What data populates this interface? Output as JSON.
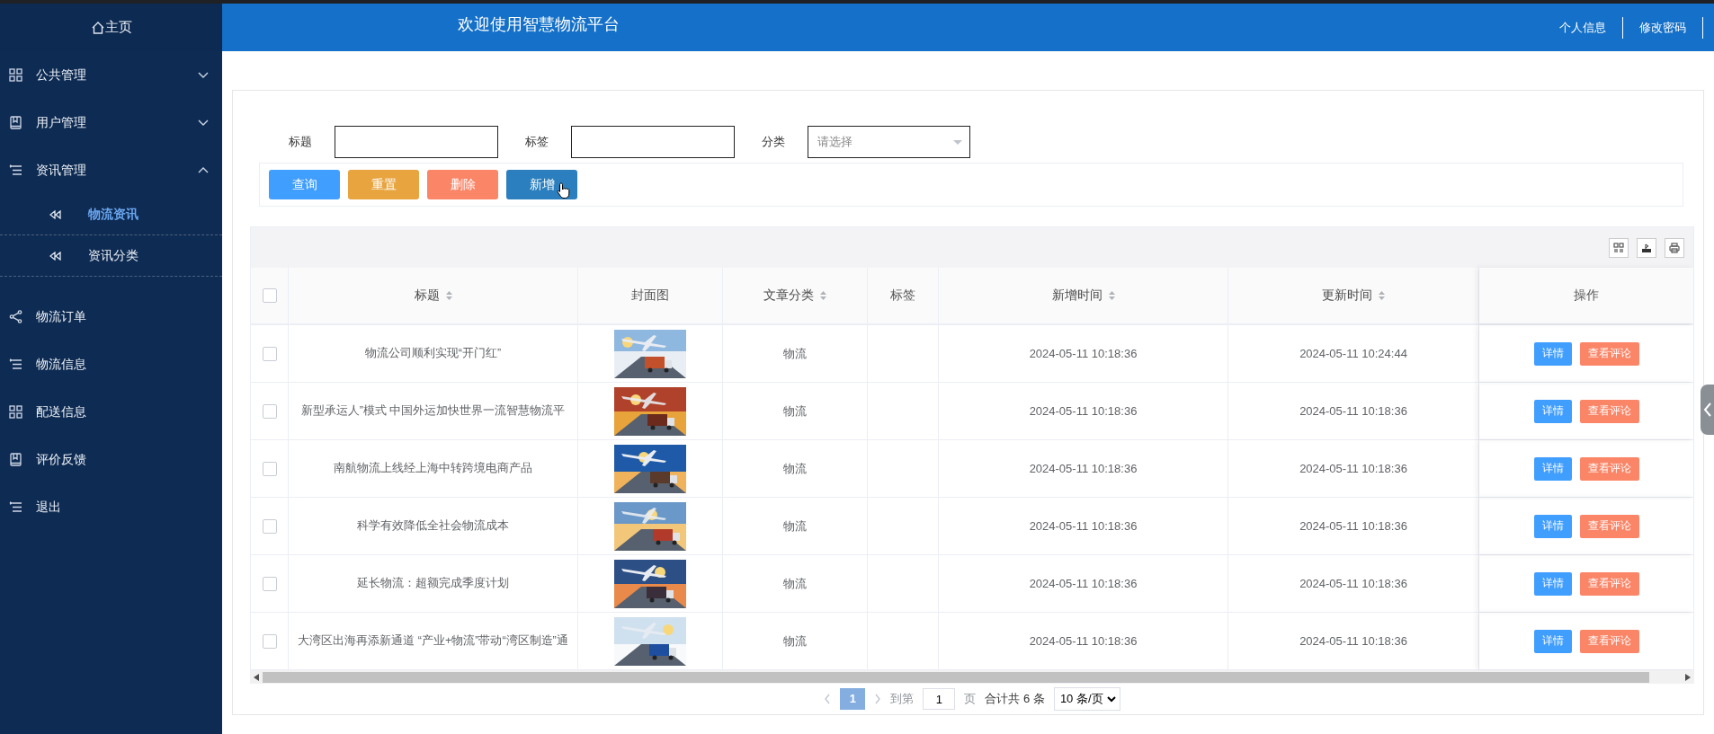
{
  "sidebar": {
    "home": "主页",
    "items": [
      {
        "label": "公共管理",
        "kind": "group",
        "expanded": false
      },
      {
        "label": "用户管理",
        "kind": "group",
        "expanded": false
      },
      {
        "label": "资讯管理",
        "kind": "group",
        "expanded": true,
        "children": [
          {
            "label": "物流资讯",
            "selected": true
          },
          {
            "label": "资讯分类",
            "selected": false
          }
        ]
      },
      {
        "label": "物流订单",
        "kind": "link"
      },
      {
        "label": "物流信息",
        "kind": "link"
      },
      {
        "label": "配送信息",
        "kind": "link"
      },
      {
        "label": "评价反馈",
        "kind": "link"
      },
      {
        "label": "退出",
        "kind": "link"
      }
    ]
  },
  "header": {
    "title": "欢迎使用智慧物流平台",
    "links": [
      "个人信息",
      "修改密码"
    ]
  },
  "filters": [
    {
      "label": "标题",
      "kind": "text"
    },
    {
      "label": "标签",
      "kind": "text"
    },
    {
      "label": "分类",
      "kind": "select",
      "placeholder": "请选择"
    }
  ],
  "actions": [
    {
      "label": "查询",
      "kind": "search",
      "hovered": false
    },
    {
      "label": "重置",
      "kind": "reset",
      "hovered": false
    },
    {
      "label": "删除",
      "kind": "delete",
      "hovered": false
    },
    {
      "label": "新增",
      "kind": "add",
      "hovered": true
    }
  ],
  "table": {
    "all_checked": false,
    "columns": [
      {
        "label": "标题",
        "sortable": true
      },
      {
        "label": "封面图",
        "sortable": false
      },
      {
        "label": "文章分类",
        "sortable": true
      },
      {
        "label": "标签",
        "sortable": false
      },
      {
        "label": "新增时间",
        "sortable": true
      },
      {
        "label": "更新时间",
        "sortable": true
      },
      {
        "label": "操作",
        "sortable": false
      }
    ],
    "rows": [
      {
        "checked": false,
        "title": "物流公司顺利实现“开门红”",
        "cover": {
          "kind": "picture"
        },
        "category": "物流",
        "created": "2024-05-11 10:18:36",
        "updated": "2024-05-11 10:24:44",
        "actions": [
          "详情",
          "查看评论"
        ]
      },
      {
        "checked": false,
        "title": "新型承运人”模式 中国外运加快世界一流智慧物流平",
        "cover": {
          "kind": "picture"
        },
        "category": "物流",
        "created": "2024-05-11 10:18:36",
        "updated": "2024-05-11 10:18:36",
        "actions": [
          "详情",
          "查看评论"
        ]
      },
      {
        "checked": false,
        "title": "南航物流上线经上海中转跨境电商产品",
        "cover": {
          "kind": "picture"
        },
        "category": "物流",
        "created": "2024-05-11 10:18:36",
        "updated": "2024-05-11 10:18:36",
        "actions": [
          "详情",
          "查看评论"
        ]
      },
      {
        "checked": false,
        "title": "科学有效降低全社会物流成本",
        "cover": {
          "kind": "picture"
        },
        "category": "物流",
        "created": "2024-05-11 10:18:36",
        "updated": "2024-05-11 10:18:36",
        "actions": [
          "详情",
          "查看评论"
        ]
      },
      {
        "checked": false,
        "title": "延长物流：超额完成季度计划",
        "cover": {
          "kind": "picture"
        },
        "category": "物流",
        "created": "2024-05-11 10:18:36",
        "updated": "2024-05-11 10:18:36",
        "actions": [
          "详情",
          "查看评论"
        ]
      },
      {
        "checked": false,
        "title": "大湾区出海再添新通道 “产业+物流”带动“湾区制造”通",
        "cover": {
          "kind": "picture"
        },
        "category": "物流",
        "created": "2024-05-11 10:18:36",
        "updated": "2024-05-11 10:18:36",
        "actions": [
          "详情",
          "查看评论"
        ]
      }
    ]
  },
  "pagination": {
    "pages": [
      {
        "label": "1",
        "selected": true
      }
    ],
    "goto_label": "到第",
    "goto_value": "1",
    "page_unit": "页",
    "total": "合计共 6 条",
    "page_size": "10 条/页"
  }
}
